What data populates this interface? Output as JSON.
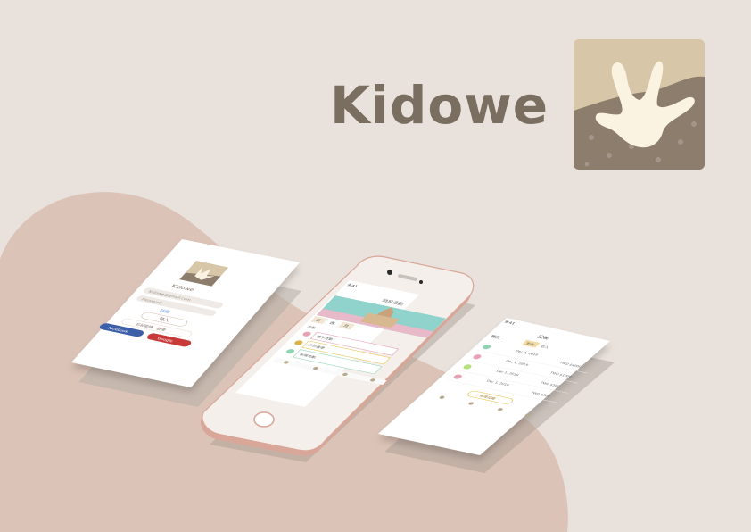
{
  "brand": {
    "name": "Kidowe",
    "icon": "dinosaur-footprint-icon",
    "colors": {
      "background": "#e9e1db",
      "blob": "#dcc3b7",
      "title": "#7a6e61",
      "icon_bg": "#d7c6a8",
      "icon_ground": "#8c7d6c",
      "footprint": "#fbf3e1"
    }
  },
  "login_screen": {
    "app_name": "Kidowe",
    "email_placeholder": "Kidowe@gmail.com",
    "password_placeholder": "Password",
    "register_link": "註冊",
    "login_button": "登入",
    "forgot_password": "忘記密碼 · 註冊",
    "facebook_button": "facebook",
    "google_button": "Google"
  },
  "home_screen": {
    "time": "9:41",
    "title": "幼兒活動",
    "tabs": [
      "日",
      "週",
      "月"
    ],
    "section_label": "活動",
    "items": [
      "親子活動",
      "戶外教學",
      "新增活動"
    ]
  },
  "records_screen": {
    "time": "9:41",
    "title": "記帳",
    "tab_left": "支出",
    "tab_right": "收入",
    "category": "類別",
    "entries": [
      {
        "date": "Dec 1, 2019",
        "amount": "TWD $4000"
      },
      {
        "date": "Dec 1, 2019",
        "amount": "TWD $1000"
      },
      {
        "date": "Dec 1, 2019",
        "amount": "TWD $500"
      },
      {
        "date": "Dec 1, 2019",
        "amount": "TWD $300"
      }
    ],
    "add_record": "+ 新增記帳"
  }
}
